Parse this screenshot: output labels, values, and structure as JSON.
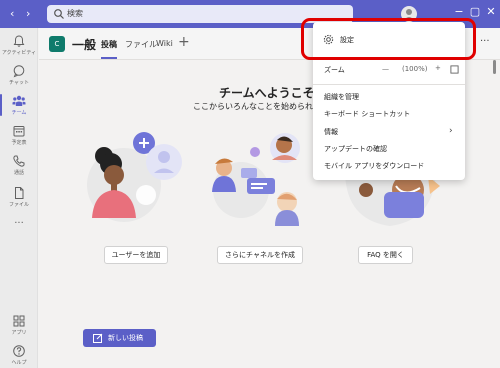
{
  "titlebar": {
    "search_placeholder": "検索",
    "back": "‹",
    "forward": "›"
  },
  "rail": {
    "items": [
      {
        "label": "アクティビティ",
        "icon": "bell-icon"
      },
      {
        "label": "チャット",
        "icon": "chat-icon"
      },
      {
        "label": "チーム",
        "icon": "teams-icon"
      },
      {
        "label": "予定表",
        "icon": "calendar-icon"
      },
      {
        "label": "通話",
        "icon": "phone-icon"
      },
      {
        "label": "ファイル",
        "icon": "file-icon"
      },
      {
        "label": "アプリ",
        "icon": "apps-icon"
      },
      {
        "label": "ヘルプ",
        "icon": "help-icon"
      }
    ],
    "more": "···"
  },
  "header": {
    "team_initial": "C",
    "channel_name": "一般",
    "tabs": [
      {
        "label": "投稿"
      },
      {
        "label": "ファイル"
      },
      {
        "label": "Wiki"
      }
    ],
    "add_tab": "+",
    "more": "···"
  },
  "welcome": {
    "title": "チームへようこそ!",
    "subtitle": "ここからいろんなことを始められま",
    "actions": [
      {
        "label": "ユーザーを追加"
      },
      {
        "label": "さらにチャネルを作成"
      },
      {
        "label": "FAQ を開く"
      }
    ],
    "new_post": "新しい投稿"
  },
  "menu": {
    "settings": "設定",
    "zoom_label": "ズーム",
    "zoom_minus": "—",
    "zoom_value": "(100%)",
    "zoom_plus": "+",
    "items": [
      {
        "label": "組織を管理"
      },
      {
        "label": "キーボード ショートカット"
      },
      {
        "label": "情報"
      },
      {
        "label": "アップデートの確認"
      },
      {
        "label": "モバイル アプリをダウンロード"
      }
    ]
  },
  "colors": {
    "brand": "#5b5fc7",
    "highlight": "#e00000"
  }
}
